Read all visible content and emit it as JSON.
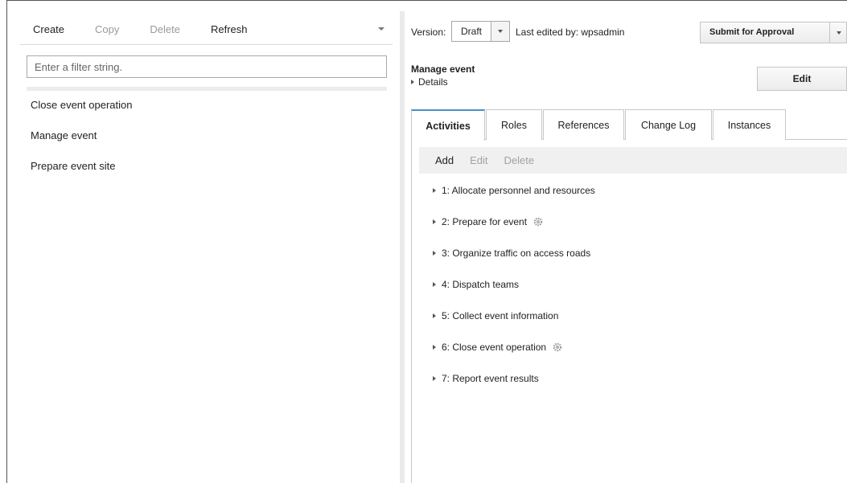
{
  "left_panel": {
    "toolbar": {
      "create": "Create",
      "copy": "Copy",
      "delete": "Delete",
      "refresh": "Refresh"
    },
    "filter": {
      "placeholder": "Enter a filter string.",
      "value": ""
    },
    "processes": [
      "Close event operation",
      "Manage event",
      "Prepare event site"
    ]
  },
  "right_panel": {
    "version_label": "Version:",
    "version_value": "Draft",
    "last_edited": "Last edited by: wpsadmin",
    "submit_label": "Submit for Approval",
    "process_title": "Manage event",
    "details_label": "Details",
    "edit_label": "Edit",
    "tabs": [
      "Activities",
      "Roles",
      "References",
      "Change Log",
      "Instances"
    ],
    "active_tab": "Activities",
    "activity_toolbar": {
      "add": "Add",
      "edit": "Edit",
      "delete": "Delete"
    },
    "activities": [
      {
        "label": "1: Allocate personnel and resources",
        "icon": ""
      },
      {
        "label": "2: Prepare for event",
        "icon": "gear-icon"
      },
      {
        "label": "3: Organize traffic on access roads",
        "icon": ""
      },
      {
        "label": "4: Dispatch teams",
        "icon": ""
      },
      {
        "label": "5: Collect event information",
        "icon": ""
      },
      {
        "label": "6: Close event operation",
        "icon": "gear-icon"
      },
      {
        "label": "7: Report event results",
        "icon": ""
      }
    ]
  },
  "colors": {
    "accent": "#4a90c8",
    "disabled_text": "#9a9a9a"
  }
}
